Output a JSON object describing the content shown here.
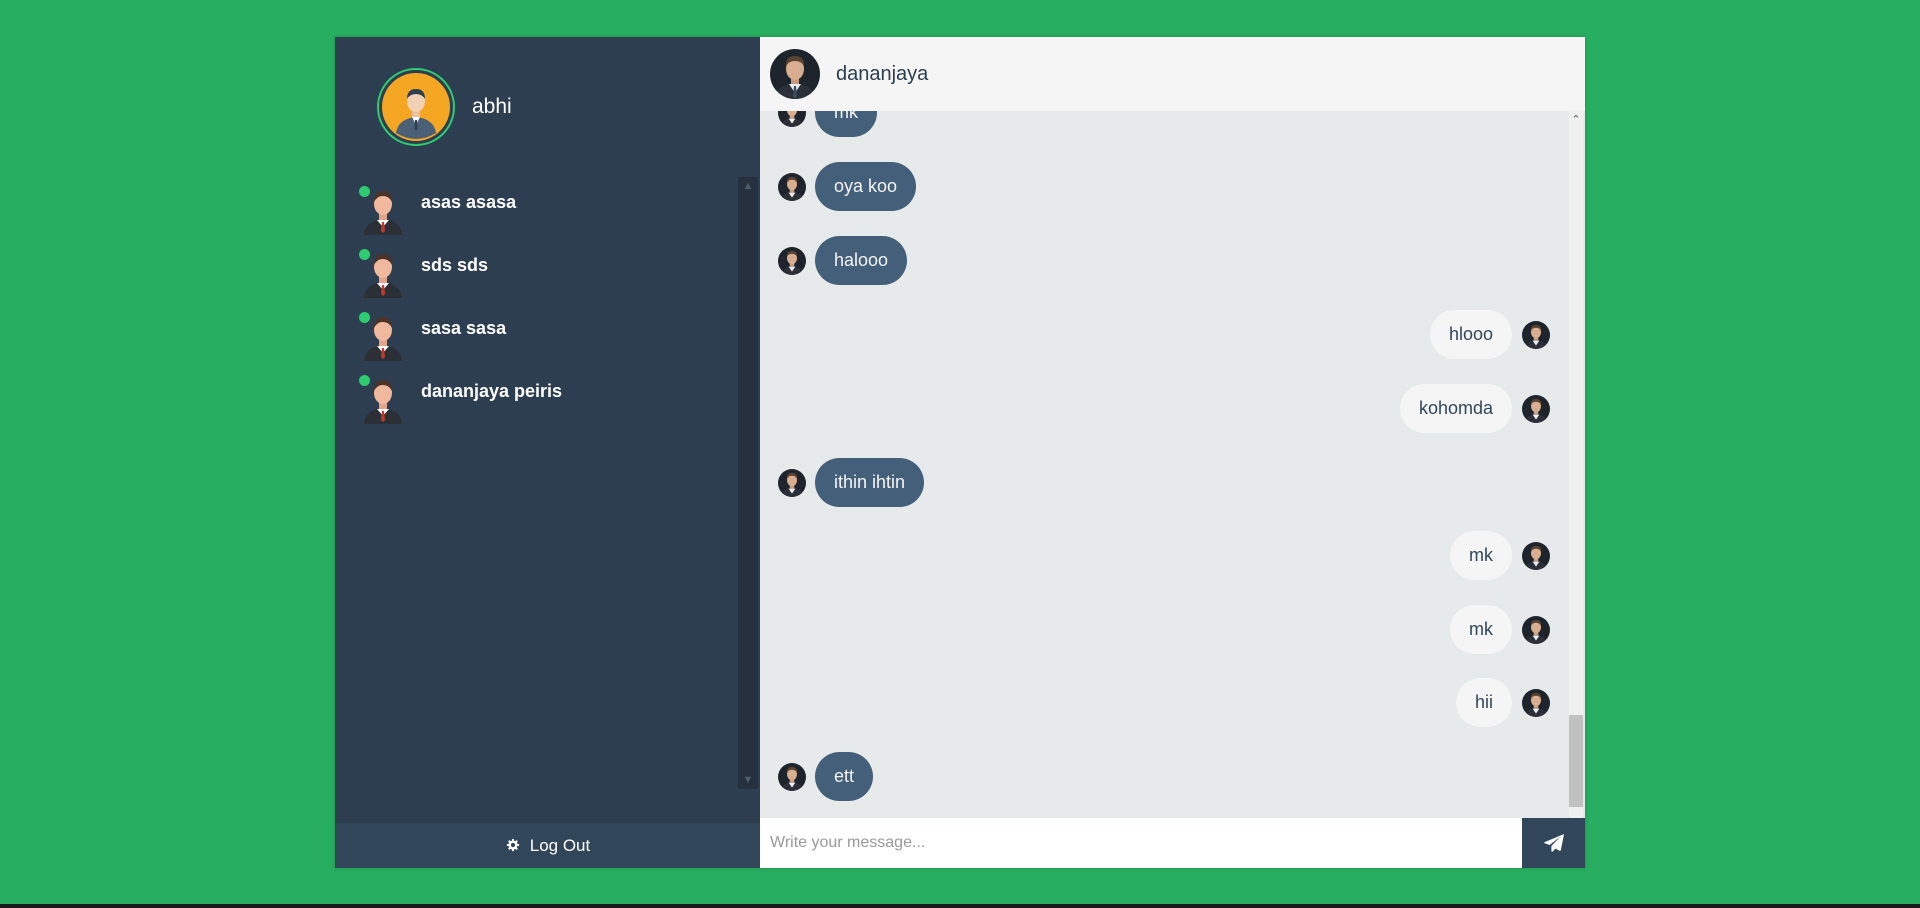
{
  "colors": {
    "page_background": "#27ae60",
    "sidebar": "#2c3e50",
    "sent_bubble": "#435f7a",
    "reply_bubble": "#f5f5f5",
    "online": "#2ecc71"
  },
  "profile": {
    "name": "abhi",
    "avatar_icon": "user-avatar-icon"
  },
  "contacts": [
    {
      "name": "asas asasa",
      "status": "online"
    },
    {
      "name": "sds sds",
      "status": "online"
    },
    {
      "name": "sasa sasa",
      "status": "online"
    },
    {
      "name": "dananjaya peiris",
      "status": "online"
    }
  ],
  "logout": {
    "label": "Log Out",
    "icon": "gear-icon"
  },
  "chat": {
    "contact_name": "dananjaya",
    "messages": [
      {
        "type": "sent",
        "text": "mk"
      },
      {
        "type": "sent",
        "text": "oya koo"
      },
      {
        "type": "sent",
        "text": "halooo"
      },
      {
        "type": "replies",
        "text": "hlooo"
      },
      {
        "type": "replies",
        "text": "kohomda"
      },
      {
        "type": "sent",
        "text": "ithin ihtin"
      },
      {
        "type": "replies",
        "text": "mk"
      },
      {
        "type": "replies",
        "text": "mk"
      },
      {
        "type": "replies",
        "text": "hii"
      },
      {
        "type": "sent",
        "text": "ett"
      }
    ]
  },
  "composer": {
    "placeholder": "Write your message...",
    "value": "",
    "send_icon": "paper-plane-icon"
  }
}
